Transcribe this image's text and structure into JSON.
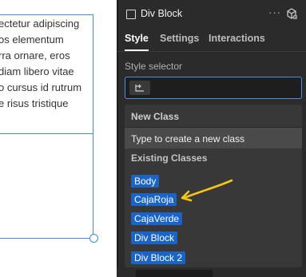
{
  "canvas": {
    "paragraph_lines": [
      "ectetur adipiscing",
      "os elementum",
      "rra ornare, eros",
      "diam libero vitae",
      "o cursus id rutrum",
      "e risus tristique"
    ]
  },
  "panel": {
    "element_name": "Div Block",
    "more_icon": "more-horizontal-icon",
    "component_icon": "component-icon",
    "tabs": [
      {
        "label": "Style",
        "active": true
      },
      {
        "label": "Settings",
        "active": false
      },
      {
        "label": "Interactions",
        "active": false
      }
    ],
    "style_selector_label": "Style selector",
    "dropdown": {
      "new_class_header": "New Class",
      "new_class_hint": "Type to create a new class",
      "existing_header": "Existing Classes",
      "classes": [
        "Body",
        "CajaRoja",
        "CajaVerde",
        "Div Block",
        "Div Block 2"
      ]
    }
  },
  "colors": {
    "panel_bg": "#2b2b2b",
    "selection_blue": "#3d8ee0",
    "chip_blue": "#1a64c8",
    "annotation_arrow": "#f5c518"
  }
}
